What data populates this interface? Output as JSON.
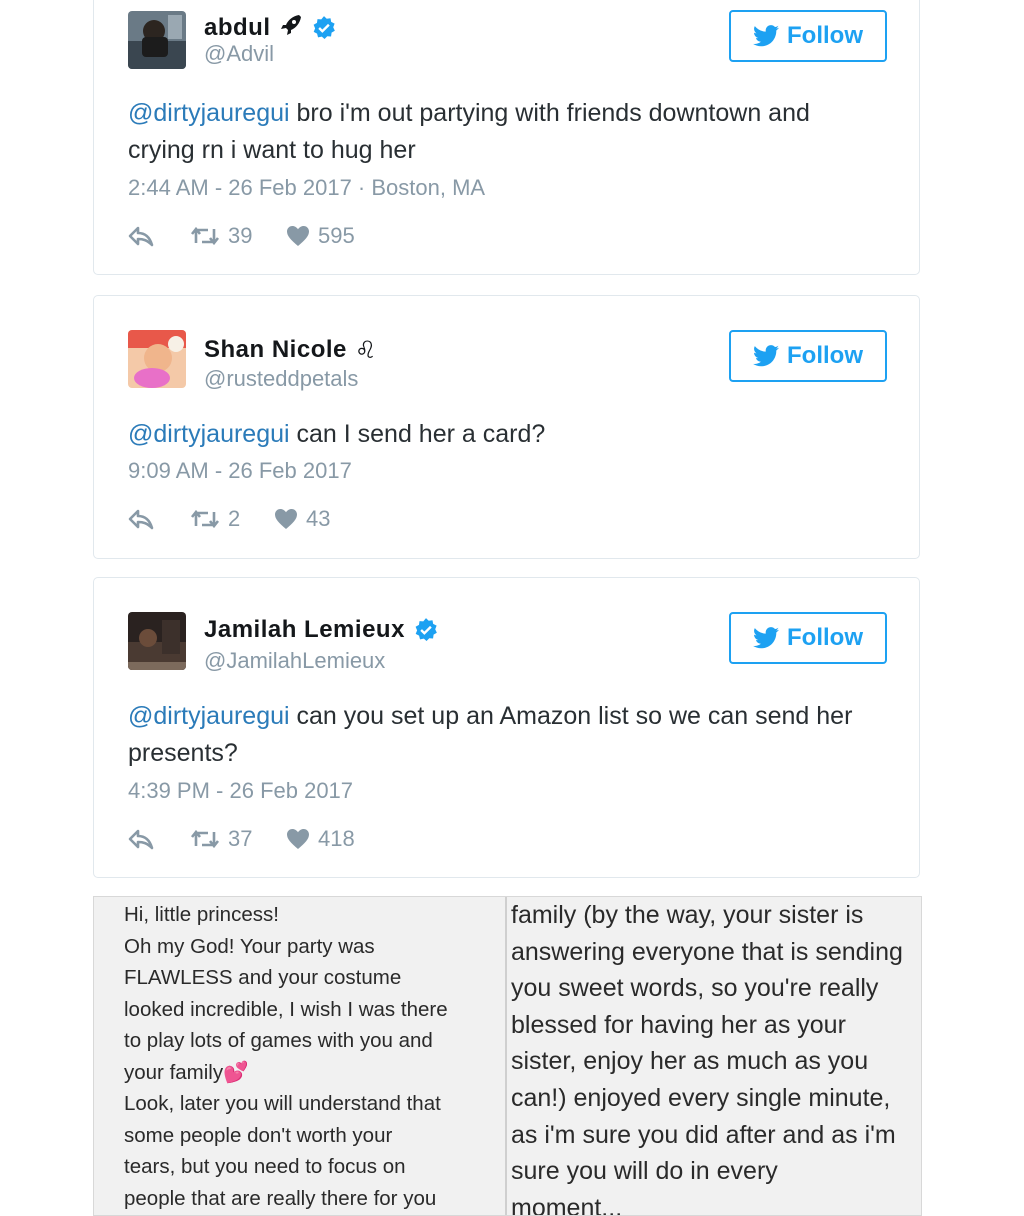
{
  "follow_label": "Follow",
  "colors": {
    "accent": "#1da1f2",
    "mention": "#2b7bb9",
    "muted": "#8899a6"
  },
  "tweets": [
    {
      "name": "abdul",
      "name_emoji": "rocket-icon",
      "verified": true,
      "handle": "@Advil",
      "mention": "@dirtyjauregui",
      "text": " bro i'm out partying with friends downtown and crying rn i want to hug her",
      "meta": "2:44 AM - 26 Feb 2017 · Boston, MA",
      "retweets": "39",
      "likes": "595"
    },
    {
      "name": "Shan Nicole",
      "name_emoji": "♌",
      "verified": false,
      "handle": "@rusteddpetals",
      "mention": "@dirtyjauregui",
      "text": " can I send her a card?",
      "meta": "9:09 AM - 26 Feb 2017",
      "retweets": "2",
      "likes": "43"
    },
    {
      "name": "Jamilah Lemieux",
      "verified": true,
      "handle": "@JamilahLemieux",
      "mention": "@dirtyjauregui",
      "text": " can you set up an Amazon list so we can send her presents?",
      "meta": "4:39 PM - 26 Feb 2017",
      "retweets": "37",
      "likes": "418"
    }
  ],
  "letter": {
    "left_text": "Hi, little princess!\nOh my God! Your party was\nFLAWLESS and your costume\nlooked incredible, I wish I was there\nto play lots of games with you and\nyour family💕\nLook, later you will understand that\nsome people don't worth your\ntears, but you need to focus on\npeople that are really there for you",
    "right_text": "family (by the way, your sister is\nanswering everyone that is sending\nyou sweet words, so you're really\nblessed for having her as your\nsister, enjoy her as much as you\ncan!) enjoyed every single minute,\nas i'm sure you did after and as i'm\nsure you will do in every\nmoment..."
  }
}
